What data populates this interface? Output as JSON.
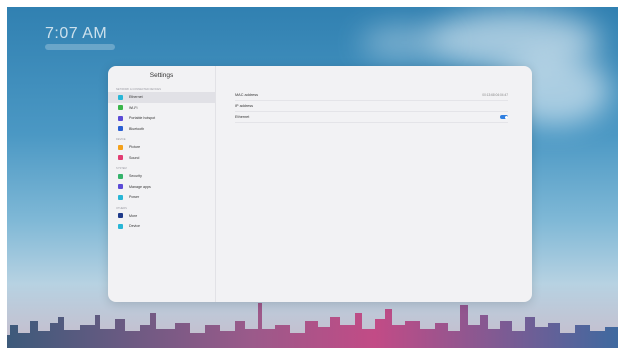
{
  "status": {
    "time": "7:07 AM"
  },
  "settings": {
    "title": "Settings",
    "sections": [
      {
        "label": "NETWORK & CONNECTED DEVICES",
        "items": [
          {
            "label": "Ethernet",
            "icon": "ethernet-icon",
            "color": "#28b6d6",
            "active": true
          },
          {
            "label": "Wi-Fi",
            "icon": "wifi-icon",
            "color": "#39b54a"
          },
          {
            "label": "Portable hotspot",
            "icon": "hotspot-icon",
            "color": "#5b4bd6"
          },
          {
            "label": "Bluetooth",
            "icon": "bluetooth-icon",
            "color": "#2b5fd3"
          }
        ]
      },
      {
        "label": "DEVICE",
        "items": [
          {
            "label": "Picture",
            "icon": "picture-icon",
            "color": "#f4a11b"
          },
          {
            "label": "Sound",
            "icon": "sound-icon",
            "color": "#e23d72"
          }
        ]
      },
      {
        "label": "SYSTEM",
        "items": [
          {
            "label": "Security",
            "icon": "security-icon",
            "color": "#35b36b"
          },
          {
            "label": "Manage apps",
            "icon": "apps-icon",
            "color": "#5b4bd6"
          },
          {
            "label": "Power",
            "icon": "power-icon",
            "color": "#28b6d6"
          }
        ]
      },
      {
        "label": "OTHERS",
        "items": [
          {
            "label": "More",
            "icon": "more-icon",
            "color": "#1f3b8a"
          },
          {
            "label": "Device",
            "icon": "device-icon",
            "color": "#28b6d6"
          }
        ]
      }
    ]
  },
  "ethernet": {
    "mac_label": "MAC address",
    "mac_value": "00:13:68:04:04:47",
    "ip_label": "IP address",
    "ethernet_label": "Ethernet",
    "ethernet_enabled": true
  }
}
